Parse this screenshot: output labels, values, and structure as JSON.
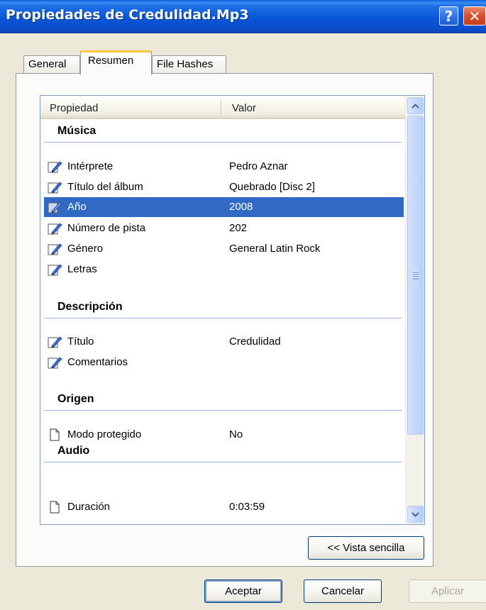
{
  "window": {
    "title": "Propiedades de Credulidad.Mp3",
    "help_glyph": "?",
    "close_glyph": "✕"
  },
  "tabs": [
    {
      "label": "General"
    },
    {
      "label": "Resumen",
      "active": true
    },
    {
      "label": "File Hashes"
    }
  ],
  "list": {
    "headers": {
      "property": "Propiedad",
      "value": "Valor"
    },
    "groups": [
      {
        "title": "Música",
        "rows": [
          {
            "name": "Intérprete",
            "value": "Pedro Aznar",
            "icon": "edit-icon"
          },
          {
            "name": "Título del álbum",
            "value": "Quebrado [Disc 2]",
            "icon": "edit-icon"
          },
          {
            "name": "Año",
            "value": "2008",
            "icon": "edit-icon",
            "selected": true
          },
          {
            "name": "Número de pista",
            "value": "202",
            "icon": "edit-icon"
          },
          {
            "name": "Género",
            "value": "General Latin Rock",
            "icon": "edit-icon"
          },
          {
            "name": "Letras",
            "value": "",
            "icon": "edit-icon"
          }
        ]
      },
      {
        "title": "Descripción",
        "rows": [
          {
            "name": "Título",
            "value": "Credulidad",
            "icon": "edit-icon"
          },
          {
            "name": "Comentarios",
            "value": "",
            "icon": "edit-icon"
          }
        ]
      },
      {
        "title": "Origen",
        "rows": [
          {
            "name": "Modo protegido",
            "value": "No",
            "icon": "document-icon"
          }
        ]
      },
      {
        "title": "Audio",
        "rows": [
          {
            "name": "Duración",
            "value": "0:03:59",
            "icon": "document-icon"
          }
        ]
      }
    ]
  },
  "buttons": {
    "vista": "<< Vista sencilla",
    "ok": "Aceptar",
    "cancel": "Cancelar",
    "apply": "Aplicar"
  },
  "colors": {
    "selection": "#316ac5",
    "titlebar": "#0b56d6",
    "active_tab_accent": "#ffc73c"
  }
}
